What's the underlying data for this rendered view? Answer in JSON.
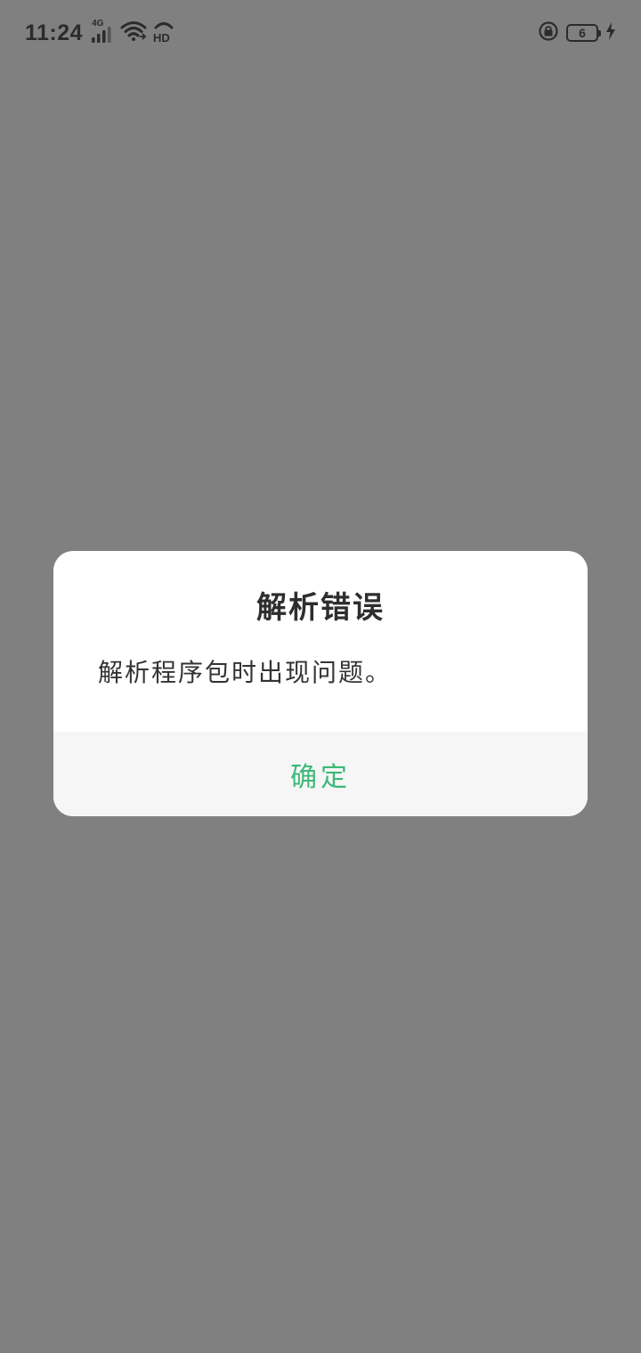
{
  "status_bar": {
    "time": "11:24",
    "network_type": "4G",
    "hd_label": "HD",
    "battery_level": "6",
    "icons": [
      "signal-icon",
      "wifi-icon",
      "hd-call-icon",
      "rotation-lock-icon",
      "battery-icon",
      "charging-icon"
    ]
  },
  "dialog": {
    "title": "解析错误",
    "message": "解析程序包时出现问题。",
    "confirm_label": "确定"
  },
  "colors": {
    "overlay": "#808080",
    "dialog_bg": "#ffffff",
    "footer_bg": "#f6f6f6",
    "accent": "#3cb878",
    "text": "#333333"
  }
}
